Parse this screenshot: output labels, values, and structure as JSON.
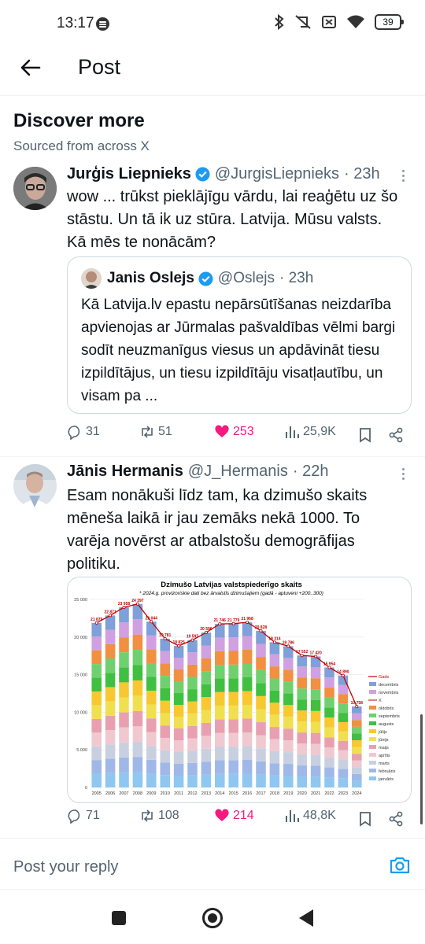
{
  "status": {
    "time": "13:17",
    "battery": "39"
  },
  "header": {
    "title": "Post"
  },
  "discover": {
    "title": "Discover more",
    "subtitle": "Sourced from across X"
  },
  "posts": [
    {
      "name": "Jurģis Liepnieks",
      "handle": "@JurgisLiepnieks",
      "time": "· 23h",
      "text": "wow ... trūkst pieklājīgu vārdu, lai reaģētu uz šo stāstu. Un tā ik uz stūra. Latvija. Mūsu valsts. Kā mēs te nonācām?",
      "quote": {
        "name": "Janis Oslejs",
        "handle": "@Oslejs",
        "time": "· 23h",
        "text": "Kā Latvija.lv epastu nepārsūtīšanas neizdarība apvienojas ar Jūrmalas pašvaldības vēlmi bargi sodīt neuzmanīgus viesus un apdāvināt tiesu izpildītājus, un tiesu izpildītāju visatļautību, un visam pa ..."
      },
      "stats": {
        "replies": "31",
        "reposts": "51",
        "likes": "253",
        "views": "25,9K"
      }
    },
    {
      "name": "Jānis Hermanis",
      "handle": "@J_Hermanis",
      "time": "· 22h",
      "text": "Esam nonākuši līdz tam, ka dzimušo skaits mēneša laikā ir jau zemāks nekā 1000. To varēja novērst ar atbalstošu demogrāfijas politiku.",
      "stats": {
        "replies": "71",
        "reposts": "108",
        "likes": "214",
        "views": "48,8K"
      }
    }
  ],
  "reply": {
    "placeholder": "Post your reply"
  },
  "chart_data": {
    "type": "bar",
    "title": "Dzimušo Latvijas valstspiederīgo skaits",
    "subtitle": "* 2024.g. provizoriskie dati bez ārvalstīs dzimušajiem (gadā - aptuveni +200..300)",
    "categories": [
      "2005",
      "2006",
      "2007",
      "2008",
      "2009",
      "2010",
      "2011",
      "2012",
      "2013",
      "2014",
      "2015",
      "2016",
      "2017",
      "2018",
      "2019",
      "2020",
      "2021",
      "2022",
      "2023",
      "2024"
    ],
    "totals": [
      21879,
      22871,
      23958,
      24397,
      22044,
      19781,
      18825,
      19597,
      20596,
      21746,
      21779,
      21968,
      20828,
      19314,
      18786,
      17552,
      17420,
      15954,
      14890,
      10758
    ],
    "series_total_name": "Gads",
    "ylim": [
      0,
      25000
    ],
    "yticks": [
      "0",
      "5 000",
      "10 000",
      "15 000",
      "20 000",
      "25 000"
    ],
    "months": [
      "decembris",
      "novembris",
      "oktobris",
      "septembris",
      "augusts",
      "jūlijs",
      "jūnijs",
      "maijs",
      "aprīlis",
      "marts",
      "februāris",
      "janvāris"
    ],
    "legend_extra": [
      "Gads",
      "X"
    ],
    "colors": [
      "#8fc7f0",
      "#a0b8e8",
      "#c8d0e0",
      "#f0c8d0",
      "#e8a0b0",
      "#f0e050",
      "#f8c830",
      "#40c040",
      "#70d070",
      "#f09040",
      "#d0a0e0",
      "#7fa0d8"
    ]
  }
}
